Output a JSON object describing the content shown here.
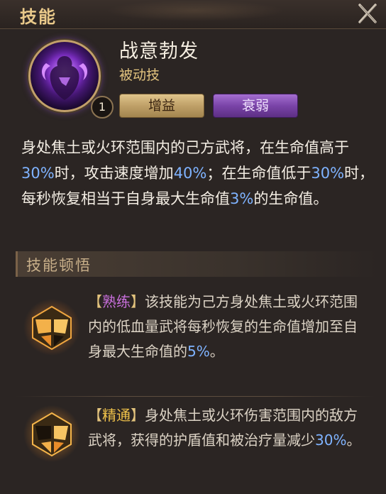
{
  "header": {
    "title": "技能"
  },
  "skill": {
    "name": "战意勃发",
    "type": "被动技",
    "level": "1",
    "tags": [
      "增益",
      "衰弱"
    ]
  },
  "description": {
    "s1": "身处焦土或火环范围内的己方武将，在生命值高于",
    "n1": "30%",
    "s2": "时，攻击速度增加",
    "n2": "40%",
    "s3": "；在生命值低于",
    "n3": "30%",
    "s4": "时，每秒恢复相当于自身最大生命值",
    "n4": "3%",
    "s5": "的生命值。"
  },
  "insight": {
    "title": "技能顿悟",
    "items": [
      {
        "open": "【",
        "name": "熟练",
        "close": "】",
        "text": "该技能为己方身处焦土或火环范围内的低血量武将每秒恢复的生命值增加至自身最大生命值的",
        "num": "5%",
        "tail": "。",
        "name_color": "#c96fdc"
      },
      {
        "open": "【",
        "name": "精通",
        "close": "】",
        "text": "身处焦土或火环伤害范围内的敌方武将，获得的护盾值和被治疗量减少",
        "num": "30%",
        "tail": "。",
        "name_color": "#f0c24a"
      }
    ]
  },
  "colors": {
    "accent_gold": "#e3c47f",
    "number_blue": "#7fb3ff",
    "buff_tag": "#bfa068",
    "debuff_tag": "#7a44a8"
  }
}
